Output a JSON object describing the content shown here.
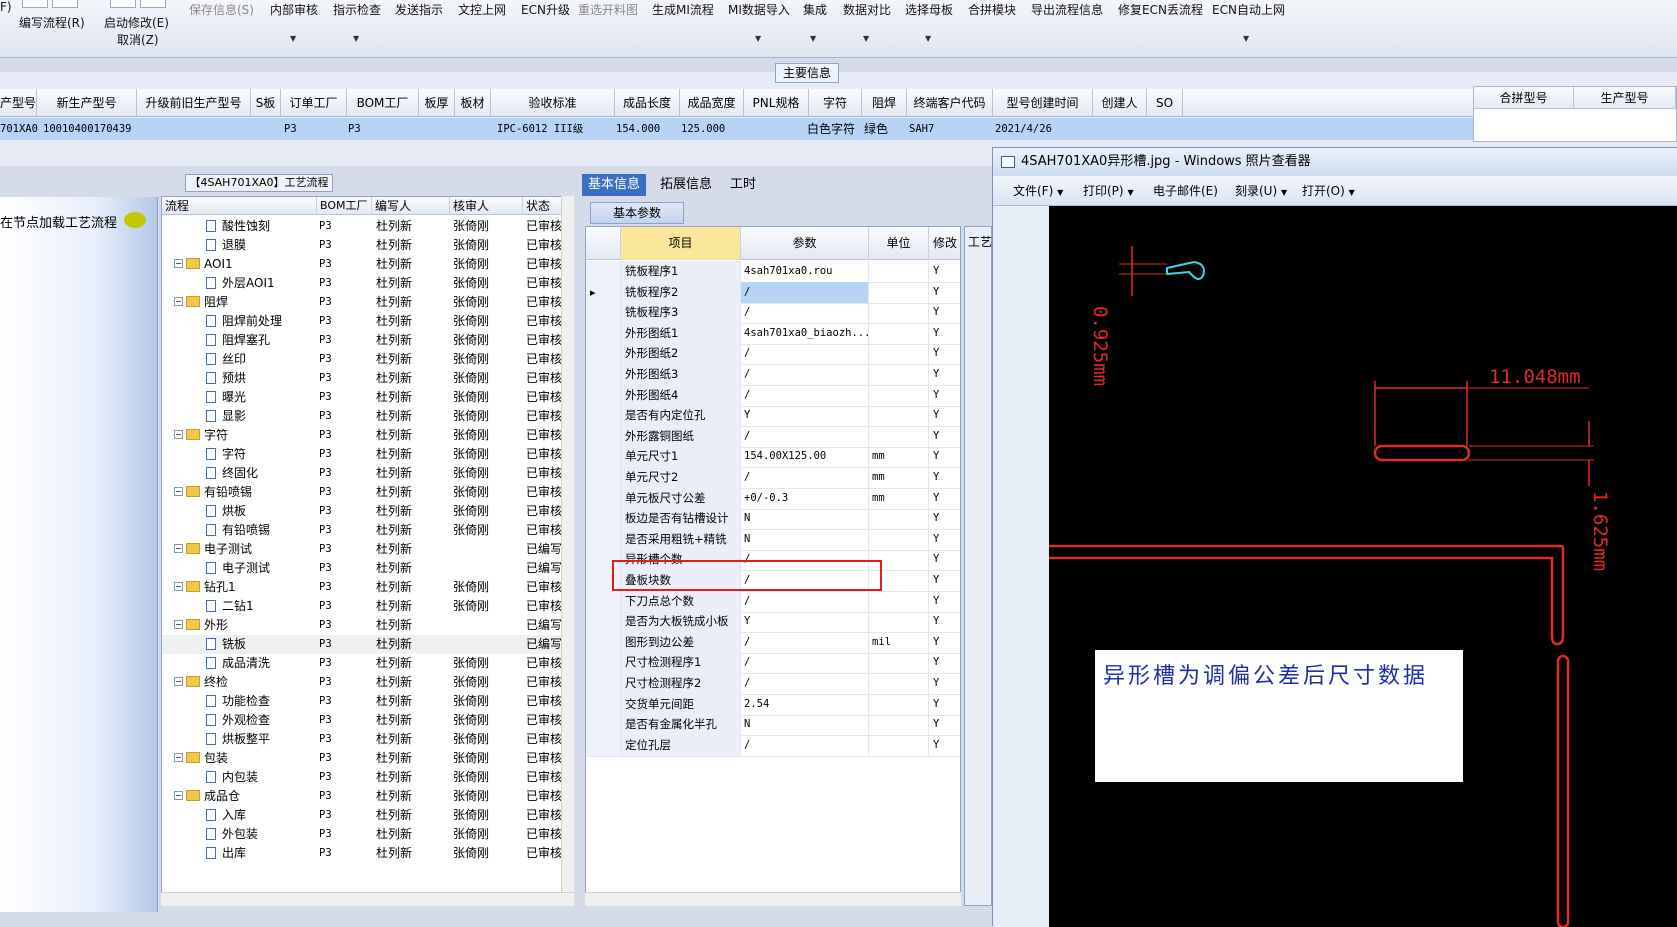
{
  "toolbar": {
    "buttons": [
      {
        "label": "F)",
        "sub": ""
      },
      {
        "label": "编写流程(R)",
        "sub": ""
      },
      {
        "label": "启动修改(E)",
        "sub": "取消(Z)"
      },
      {
        "label": "保存信息(S)",
        "disabled": true
      },
      {
        "label": "内部审核"
      },
      {
        "label": "指示检查"
      },
      {
        "label": "发送指示"
      },
      {
        "label": "文控上网"
      },
      {
        "label": "ECN升级"
      },
      {
        "label": "重选开料图",
        "disabled": true
      },
      {
        "label": "生成MI流程"
      },
      {
        "label": "MI数据导入"
      },
      {
        "label": "集成"
      },
      {
        "label": "数据对比"
      },
      {
        "label": "选择母板"
      },
      {
        "label": "合拼模块"
      },
      {
        "label": "导出流程信息"
      },
      {
        "label": "修复ECN丢流程"
      },
      {
        "label": "ECN自动上网"
      }
    ]
  },
  "main_info": {
    "section_label": "主要信息",
    "headers": [
      "产型号",
      "新生产型号",
      "升级前旧生产型号",
      "S板",
      "订单工厂",
      "BOM工厂",
      "板厚",
      "板材",
      "验收标准",
      "成品长度",
      "成品宽度",
      "PNL规格",
      "字符",
      "阻焊",
      "终端客户代码",
      "型号创建时间",
      "创建人",
      "SO"
    ],
    "row": [
      "701XA0",
      "10010400170439",
      "",
      "",
      "P3",
      "P3",
      "",
      "",
      "IPC-6012 III级",
      "154.000",
      "125.000",
      "",
      "白色字符",
      "绿色",
      "SAH7",
      "2021/4/26",
      "",
      ""
    ],
    "side_headers": [
      "合拼型号",
      "生产型号"
    ]
  },
  "left_panel": {
    "label": "在节点加载工艺流程"
  },
  "flow": {
    "title": "【4SAH701XA0】工艺流程",
    "headers": [
      "流程",
      "BOM工厂",
      "编写人",
      "核审人",
      "状态"
    ],
    "rows": [
      {
        "name": "酸性蚀刻",
        "type": "doc",
        "bom": "P3",
        "writer": "杜列新",
        "reviewer": "张倚刚",
        "status": "已审核"
      },
      {
        "name": "退膜",
        "type": "doc",
        "bom": "P3",
        "writer": "杜列新",
        "reviewer": "张倚刚",
        "status": "已审核"
      },
      {
        "name": "AOI1",
        "type": "folder",
        "bom": "P3",
        "writer": "杜列新",
        "reviewer": "张倚刚",
        "status": "已审核"
      },
      {
        "name": "外层AOI1",
        "type": "doc",
        "bom": "P3",
        "writer": "杜列新",
        "reviewer": "张倚刚",
        "status": "已审核"
      },
      {
        "name": "阻焊",
        "type": "folder",
        "bom": "P3",
        "writer": "杜列新",
        "reviewer": "张倚刚",
        "status": "已审核"
      },
      {
        "name": "阻焊前处理",
        "type": "doc",
        "bom": "P3",
        "writer": "杜列新",
        "reviewer": "张倚刚",
        "status": "已审核"
      },
      {
        "name": "阻焊塞孔",
        "type": "doc",
        "bom": "P3",
        "writer": "杜列新",
        "reviewer": "张倚刚",
        "status": "已审核"
      },
      {
        "name": "丝印",
        "type": "doc",
        "bom": "P3",
        "writer": "杜列新",
        "reviewer": "张倚刚",
        "status": "已审核"
      },
      {
        "name": "预烘",
        "type": "doc",
        "bom": "P3",
        "writer": "杜列新",
        "reviewer": "张倚刚",
        "status": "已审核"
      },
      {
        "name": "曝光",
        "type": "doc",
        "bom": "P3",
        "writer": "杜列新",
        "reviewer": "张倚刚",
        "status": "已审核"
      },
      {
        "name": "显影",
        "type": "doc",
        "bom": "P3",
        "writer": "杜列新",
        "reviewer": "张倚刚",
        "status": "已审核"
      },
      {
        "name": "字符",
        "type": "folder",
        "bom": "P3",
        "writer": "杜列新",
        "reviewer": "张倚刚",
        "status": "已审核"
      },
      {
        "name": "字符",
        "type": "doc",
        "bom": "P3",
        "writer": "杜列新",
        "reviewer": "张倚刚",
        "status": "已审核"
      },
      {
        "name": "终固化",
        "type": "doc",
        "bom": "P3",
        "writer": "杜列新",
        "reviewer": "张倚刚",
        "status": "已审核"
      },
      {
        "name": "有铅喷锡",
        "type": "folder",
        "bom": "P3",
        "writer": "杜列新",
        "reviewer": "张倚刚",
        "status": "已审核"
      },
      {
        "name": "烘板",
        "type": "doc",
        "bom": "P3",
        "writer": "杜列新",
        "reviewer": "张倚刚",
        "status": "已审核"
      },
      {
        "name": "有铅喷锡",
        "type": "doc",
        "bom": "P3",
        "writer": "杜列新",
        "reviewer": "张倚刚",
        "status": "已审核"
      },
      {
        "name": "电子测试",
        "type": "folder",
        "bom": "P3",
        "writer": "杜列新",
        "reviewer": "",
        "status": "已编写"
      },
      {
        "name": "电子测试",
        "type": "doc",
        "bom": "P3",
        "writer": "杜列新",
        "reviewer": "",
        "status": "已编写"
      },
      {
        "name": "钻孔1",
        "type": "folder",
        "bom": "P3",
        "writer": "杜列新",
        "reviewer": "张倚刚",
        "status": "已审核"
      },
      {
        "name": "二钻1",
        "type": "doc",
        "bom": "P3",
        "writer": "杜列新",
        "reviewer": "张倚刚",
        "status": "已审核"
      },
      {
        "name": "外形",
        "type": "folder",
        "bom": "P3",
        "writer": "杜列新",
        "reviewer": "",
        "status": "已编写"
      },
      {
        "name": "铣板",
        "type": "doc",
        "bom": "P3",
        "writer": "杜列新",
        "reviewer": "",
        "status": "已编写",
        "selected": true
      },
      {
        "name": "成品清洗",
        "type": "doc",
        "bom": "P3",
        "writer": "杜列新",
        "reviewer": "张倚刚",
        "status": "已审核"
      },
      {
        "name": "终检",
        "type": "folder",
        "bom": "P3",
        "writer": "杜列新",
        "reviewer": "张倚刚",
        "status": "已审核"
      },
      {
        "name": "功能检查",
        "type": "doc",
        "bom": "P3",
        "writer": "杜列新",
        "reviewer": "张倚刚",
        "status": "已审核"
      },
      {
        "name": "外观检查",
        "type": "doc",
        "bom": "P3",
        "writer": "杜列新",
        "reviewer": "张倚刚",
        "status": "已审核"
      },
      {
        "name": "烘板整平",
        "type": "doc",
        "bom": "P3",
        "writer": "杜列新",
        "reviewer": "张倚刚",
        "status": "已审核"
      },
      {
        "name": "包装",
        "type": "folder",
        "bom": "P3",
        "writer": "杜列新",
        "reviewer": "张倚刚",
        "status": "已审核"
      },
      {
        "name": "内包装",
        "type": "doc",
        "bom": "P3",
        "writer": "杜列新",
        "reviewer": "张倚刚",
        "status": "已审核"
      },
      {
        "name": "成品仓",
        "type": "folder",
        "bom": "P3",
        "writer": "杜列新",
        "reviewer": "张倚刚",
        "status": "已审核"
      },
      {
        "name": "入库",
        "type": "doc",
        "bom": "P3",
        "writer": "杜列新",
        "reviewer": "张倚刚",
        "status": "已审核"
      },
      {
        "name": "外包装",
        "type": "doc",
        "bom": "P3",
        "writer": "杜列新",
        "reviewer": "张倚刚",
        "status": "已审核"
      },
      {
        "name": "出库",
        "type": "doc",
        "bom": "P3",
        "writer": "杜列新",
        "reviewer": "张倚刚",
        "status": "已审核"
      }
    ]
  },
  "params": {
    "tabs": [
      "基本信息",
      "拓展信息",
      "工时"
    ],
    "subtab": "基本参数",
    "headers": [
      "项目",
      "参数",
      "单位",
      "修改"
    ],
    "right_stub_label": "工艺",
    "rows": [
      {
        "item": "铣板程序1",
        "param": "4sah701xa0.rou",
        "unit": "",
        "mod": "Y"
      },
      {
        "item": "铣板程序2",
        "param": "/",
        "unit": "",
        "mod": "Y",
        "current": true
      },
      {
        "item": "铣板程序3",
        "param": "/",
        "unit": "",
        "mod": "Y"
      },
      {
        "item": "外形图纸1",
        "param": "4sah701xa0_biaozh...",
        "unit": "",
        "mod": "Y"
      },
      {
        "item": "外形图纸2",
        "param": "/",
        "unit": "",
        "mod": "Y"
      },
      {
        "item": "外形图纸3",
        "param": "/",
        "unit": "",
        "mod": "Y"
      },
      {
        "item": "外形图纸4",
        "param": "/",
        "unit": "",
        "mod": "Y"
      },
      {
        "item": "是否有内定位孔",
        "param": "Y",
        "unit": "",
        "mod": "Y"
      },
      {
        "item": "外形露铜图纸",
        "param": "/",
        "unit": "",
        "mod": "Y"
      },
      {
        "item": "单元尺寸1",
        "param": "154.00X125.00",
        "unit": "mm",
        "mod": "Y"
      },
      {
        "item": "单元尺寸2",
        "param": "/",
        "unit": "mm",
        "mod": "Y"
      },
      {
        "item": "单元板尺寸公差",
        "param": "+0/-0.3",
        "unit": "mm",
        "mod": "Y"
      },
      {
        "item": "板边是否有钻槽设计",
        "param": "N",
        "unit": "",
        "mod": "Y"
      },
      {
        "item": "是否采用粗铣+精铣",
        "param": "N",
        "unit": "",
        "mod": "Y"
      },
      {
        "item": "异形槽个数",
        "param": "/",
        "unit": "",
        "mod": "Y"
      },
      {
        "item": "叠板块数",
        "param": "/",
        "unit": "",
        "mod": "Y"
      },
      {
        "item": "下刀点总个数",
        "param": "/",
        "unit": "",
        "mod": "Y"
      },
      {
        "item": "是否为大板铣成小板",
        "param": "Y",
        "unit": "",
        "mod": "Y"
      },
      {
        "item": "图形到边公差",
        "param": "/",
        "unit": "mil",
        "mod": "Y"
      },
      {
        "item": "尺寸检测程序1",
        "param": "/",
        "unit": "",
        "mod": "Y"
      },
      {
        "item": "尺寸检测程序2",
        "param": "/",
        "unit": "",
        "mod": "Y"
      },
      {
        "item": "交货单元间距",
        "param": "2.54",
        "unit": "",
        "mod": "Y"
      },
      {
        "item": "是否有金属化半孔",
        "param": "N",
        "unit": "",
        "mod": "Y"
      },
      {
        "item": "定位孔层",
        "param": "/",
        "unit": "",
        "mod": "Y"
      }
    ]
  },
  "viewer": {
    "title": "4SAH701XA0异形槽.jpg - Windows 照片查看器",
    "menu": [
      "文件(F)",
      "打印(P)",
      "电子邮件(E)",
      "刻录(U)",
      "打开(O)"
    ],
    "dims": [
      "0.925mm",
      "11.048mm",
      "1.625mm"
    ],
    "note": "异形槽为调偏公差后尺寸数据",
    "colors": {
      "drawing": "#e12a2a",
      "cyan": "#3fd6e6",
      "note": "#1e2ea8"
    }
  }
}
